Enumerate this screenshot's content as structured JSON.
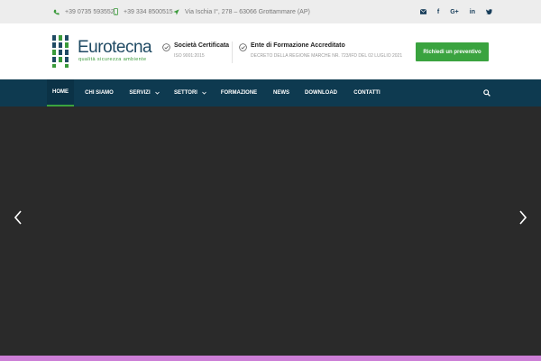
{
  "topbar": {
    "phone": "+39 0735 593552",
    "mobile": "+39 334 8500515",
    "address": "Via Ischia I°, 278 – 63066 Grottammare (AP)",
    "socials": [
      "envelope-icon",
      "facebook-icon",
      "google-plus-icon",
      "linkedin-icon",
      "twitter-icon"
    ]
  },
  "header": {
    "logo_word": "Eurotecna",
    "logo_tagline": "qualità sicurezza ambiente",
    "cert1_title": "Società Certificata",
    "cert1_sub": "ISO 9001:2015",
    "cert2_title": "Ente di Formazione Accreditato",
    "cert2_sub": "DECRETO DELLA REGIONE MARCHE NR. 723/IFD DEL 02 LUGLIO 2021",
    "cta_label": "Richiedi un preventivo"
  },
  "nav": {
    "items": [
      {
        "label": "HOME",
        "active": true
      },
      {
        "label": "CHI SIAMO"
      },
      {
        "label": "SERVIZI",
        "dropdown": true
      },
      {
        "label": "SETTORI",
        "dropdown": true
      },
      {
        "label": "FORMAZIONE"
      },
      {
        "label": "NEWS"
      },
      {
        "label": "DOWNLOAD"
      },
      {
        "label": "CONTATTI"
      }
    ]
  },
  "colors": {
    "nav_bg": "#0e3a50",
    "accent_green": "#3aa33f",
    "brand_blue": "#1f4a63",
    "slider_bg": "#2a2a2a",
    "bottom_strip": "#cc7ed6"
  }
}
